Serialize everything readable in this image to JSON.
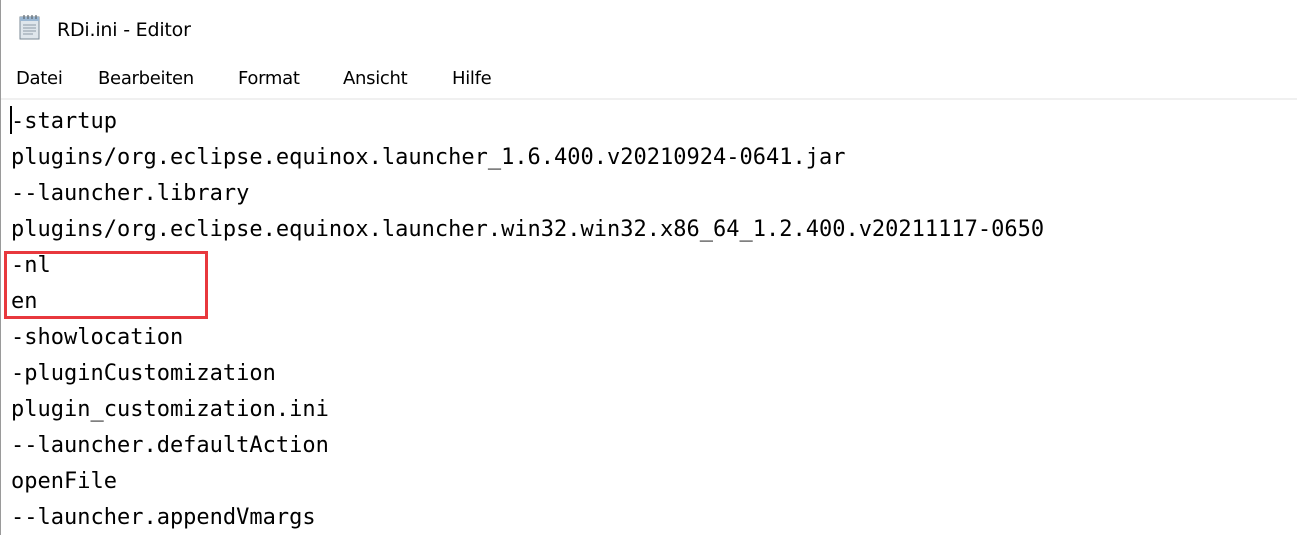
{
  "window": {
    "title": "RDi.ini - Editor",
    "app_icon": "notepad-icon"
  },
  "menu": {
    "items": [
      "Datei",
      "Bearbeiten",
      "Format",
      "Ansicht",
      "Hilfe"
    ]
  },
  "editor": {
    "lines": [
      "-startup",
      "plugins/org.eclipse.equinox.launcher_1.6.400.v20210924-0641.jar",
      "--launcher.library",
      "plugins/org.eclipse.equinox.launcher.win32.win32.x86_64_1.2.400.v20211117-0650",
      "-nl",
      "en",
      "-showlocation",
      "-pluginCustomization",
      "plugin_customization.ini",
      "--launcher.defaultAction",
      "openFile",
      "--launcher.appendVmargs"
    ]
  },
  "annotation": {
    "color": "#e8383d"
  }
}
